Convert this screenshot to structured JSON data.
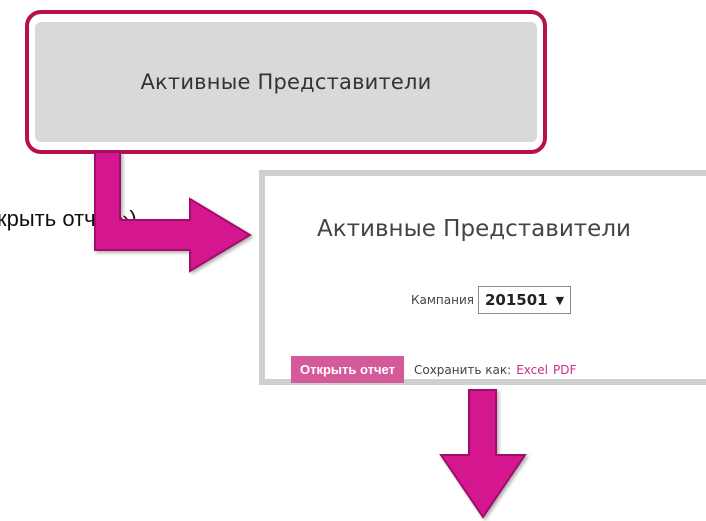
{
  "top_button": {
    "label": "Активные Представители"
  },
  "caption": {
    "text": "крыть отчет»)"
  },
  "dialog": {
    "title": "Активные Представители",
    "campaign_label": "Кампания",
    "campaign_value": "201501",
    "open_report_label": "Открыть отчет",
    "save_as_label": "Сохранить как:",
    "excel_label": "Excel",
    "pdf_label": "PDF"
  },
  "colors": {
    "accent_arrow": "#d4148f",
    "highlight_border": "#b80f4e",
    "button_pink": "#d55a9a",
    "link_pink": "#cc2d86"
  }
}
